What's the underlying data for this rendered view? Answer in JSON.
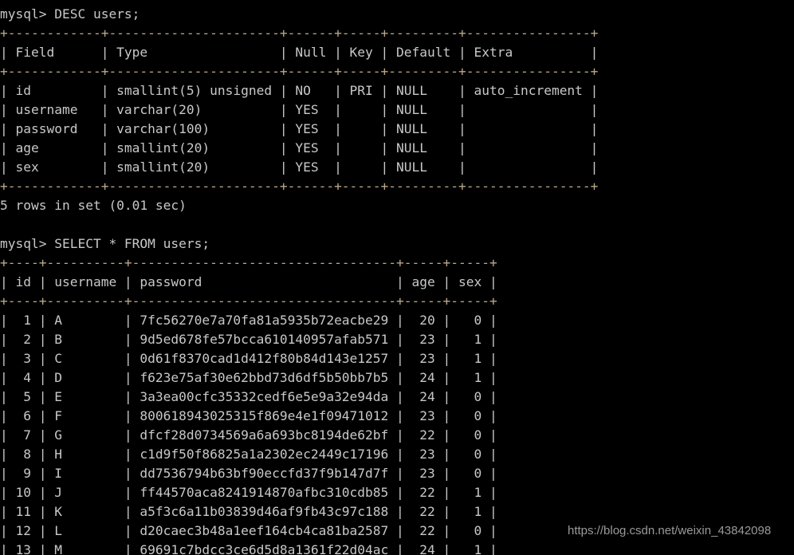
{
  "terminal": {
    "prompt": "mysql> ",
    "background": "#000000",
    "foreground": "#c8c8c8",
    "rule_color": "#b9a88c"
  },
  "watermark": {
    "text": "https://blog.csdn.net/weixin_43842098"
  },
  "blocks": [
    {
      "name": "desc-users",
      "command": "mysql> DESC users;",
      "columns": [
        "Field",
        "Type",
        "Null",
        "Key",
        "Default",
        "Extra"
      ],
      "widths": [
        12,
        22,
        6,
        5,
        9,
        16
      ],
      "rows": [
        [
          "id",
          "smallint(5) unsigned",
          "NO",
          "PRI",
          "NULL",
          "auto_increment"
        ],
        [
          "username",
          "varchar(20)",
          "YES",
          "",
          "NULL",
          ""
        ],
        [
          "password",
          "varchar(100)",
          "YES",
          "",
          "NULL",
          ""
        ],
        [
          "age",
          "smallint(20)",
          "YES",
          "",
          "NULL",
          ""
        ],
        [
          "sex",
          "smallint(20)",
          "YES",
          "",
          "NULL",
          ""
        ]
      ],
      "status": "5 rows in set (0.01 sec)"
    },
    {
      "name": "select-users",
      "command": "mysql> SELECT * FROM users;",
      "columns": [
        "id",
        "username",
        "password",
        "age",
        "sex"
      ],
      "widths": [
        4,
        10,
        34,
        5,
        5
      ],
      "aligns": [
        "right",
        "left",
        "left",
        "right",
        "right"
      ],
      "rows": [
        [
          "1",
          "A",
          "7fc56270e7a70fa81a5935b72eacbe29",
          "20",
          "0"
        ],
        [
          "2",
          "B",
          "9d5ed678fe57bcca610140957afab571",
          "23",
          "1"
        ],
        [
          "3",
          "C",
          "0d61f8370cad1d412f80b84d143e1257",
          "23",
          "1"
        ],
        [
          "4",
          "D",
          "f623e75af30e62bbd73d6df5b50bb7b5",
          "24",
          "1"
        ],
        [
          "5",
          "E",
          "3a3ea00cfc35332cedf6e5e9a32e94da",
          "24",
          "0"
        ],
        [
          "6",
          "F",
          "800618943025315f869e4e1f09471012",
          "23",
          "0"
        ],
        [
          "7",
          "G",
          "dfcf28d0734569a6a693bc8194de62bf",
          "22",
          "0"
        ],
        [
          "8",
          "H",
          "c1d9f50f86825a1a2302ec2449c17196",
          "23",
          "0"
        ],
        [
          "9",
          "I",
          "dd7536794b63bf90eccfd37f9b147d7f",
          "23",
          "0"
        ],
        [
          "10",
          "J",
          "ff44570aca8241914870afbc310cdb85",
          "22",
          "1"
        ],
        [
          "11",
          "K",
          "a5f3c6a11b03839d46af9fb43c97c188",
          "22",
          "1"
        ],
        [
          "12",
          "L",
          "d20caec3b48a1eef164cb4ca81ba2587",
          "22",
          "0"
        ],
        [
          "13",
          "M",
          "69691c7bdcc3ce6d5d8a1361f22d04ac",
          "24",
          "1"
        ]
      ],
      "status": ""
    }
  ]
}
